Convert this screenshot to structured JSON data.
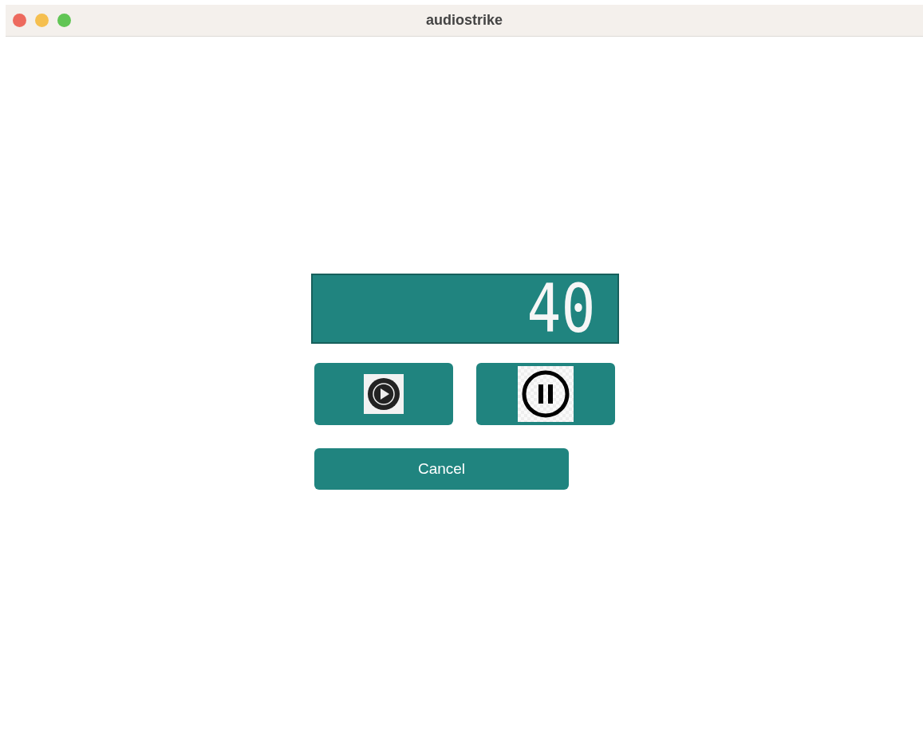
{
  "window": {
    "title": "audiostrike"
  },
  "display": {
    "reading": "40"
  },
  "media_buttons": [
    {
      "kind": "play"
    },
    {
      "kind": "pause"
    }
  ],
  "cancel_button": {
    "label": "Cancel"
  }
}
